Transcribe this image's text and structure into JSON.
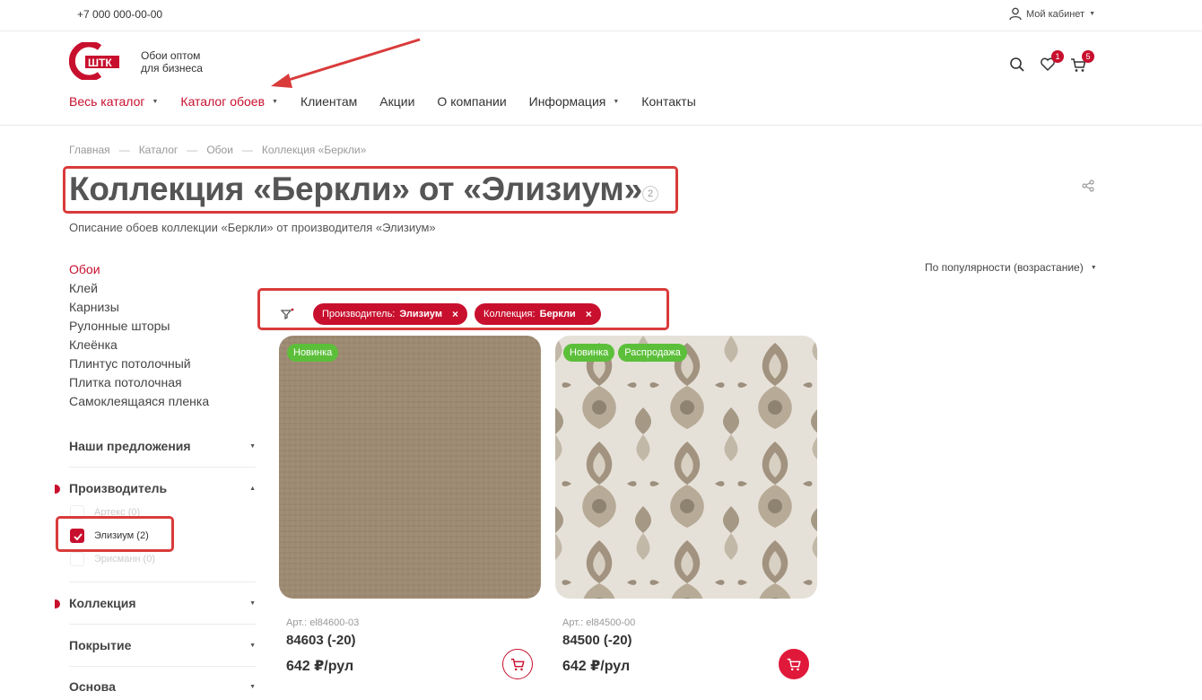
{
  "topbar": {
    "phone": "+7 000 000-00-00",
    "cabinet_label": "Мой кабинет",
    "user_icon": "user-icon"
  },
  "header": {
    "logo_text": "ШТК",
    "slogan_line1": "Обои оптом",
    "slogan_line2": "для бизнеса",
    "nav": [
      {
        "label": "Весь каталог",
        "dropdown": true,
        "active": true
      },
      {
        "label": "Каталог обоев",
        "dropdown": true,
        "active": true
      },
      {
        "label": "Клиентам",
        "dropdown": false
      },
      {
        "label": "Акции",
        "dropdown": false
      },
      {
        "label": "О компании",
        "dropdown": false
      },
      {
        "label": "Информация",
        "dropdown": true
      },
      {
        "label": "Контакты",
        "dropdown": false
      }
    ],
    "favorites_count": "1",
    "cart_count": "5",
    "icons": [
      "search-icon",
      "heart-icon",
      "cart-icon"
    ]
  },
  "breadcrumb": [
    "Главная",
    "Каталог",
    "Обои",
    "Коллекция «Беркли»"
  ],
  "page": {
    "title": "Коллекция «Беркли» от «Элизиум»",
    "count": "2",
    "description": "Описание обоев коллекции «Беркли» от производителя «Элизиум»"
  },
  "categories": [
    "Обои",
    "Клей",
    "Карнизы",
    "Рулонные шторы",
    "Клеёнка",
    "Плинтус потолочный",
    "Плитка потолочная",
    "Самоклеящаяся пленка"
  ],
  "filters": {
    "offers": "Наши предложения",
    "manufacturer": "Производитель",
    "manufacturer_options": [
      {
        "label": "Артекс (0)",
        "checked": false
      },
      {
        "label": "Элизиум (2)",
        "checked": true
      },
      {
        "label": "Эрисманн (0)",
        "checked": false
      }
    ],
    "collection": "Коллекция",
    "coating": "Покрытие",
    "base": "Основа"
  },
  "sort": {
    "label": "По популярности (возрастание)"
  },
  "active_filters": [
    {
      "name": "Производитель:",
      "value": "Элизиум"
    },
    {
      "name": "Коллекция:",
      "value": "Беркли"
    }
  ],
  "products": [
    {
      "tags": [
        "Новинка"
      ],
      "art": "Арт.: el84600-03",
      "name": "84603 (-20)",
      "price": "642 ₽/рул"
    },
    {
      "tags": [
        "Новинка",
        "Распродажа"
      ],
      "art": "Арт.: el84500-00",
      "name": "84500 (-20)",
      "price": "642 ₽/рул"
    }
  ],
  "colors": {
    "brand_red": "#c8102e",
    "tag_green": "#5cbf3a",
    "annotation_red": "#d93b3b"
  }
}
